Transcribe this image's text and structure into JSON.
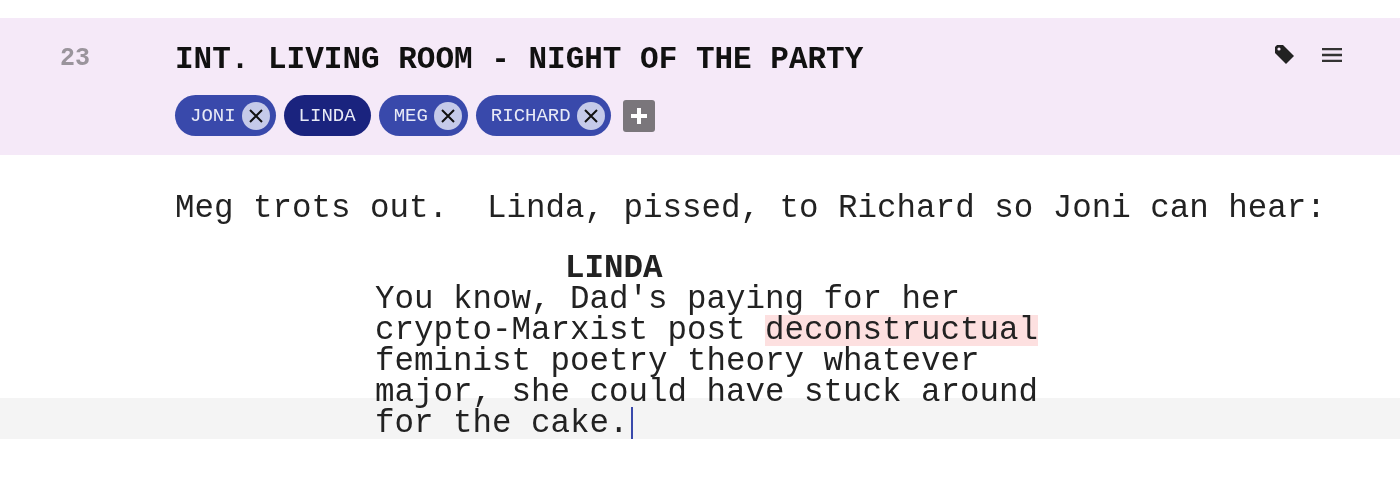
{
  "scene": {
    "number": "23",
    "heading": "INT. LIVING ROOM - NIGHT OF THE PARTY",
    "characters": [
      {
        "name": "JONI",
        "selected": false
      },
      {
        "name": "LINDA",
        "selected": true
      },
      {
        "name": "MEG",
        "selected": false
      },
      {
        "name": "RICHARD",
        "selected": false
      }
    ]
  },
  "action": "Meg trots out.  Linda, pissed, to Richard so Joni can hear:",
  "dialogue": {
    "character": "LINDA",
    "lines": [
      {
        "current": false,
        "segments": [
          {
            "text": "You know, Dad's paying for her",
            "misspelled": false
          }
        ]
      },
      {
        "current": false,
        "segments": [
          {
            "text": "crypto-Marxist post ",
            "misspelled": false
          },
          {
            "text": "deconstructual",
            "misspelled": true
          }
        ]
      },
      {
        "current": false,
        "segments": [
          {
            "text": "feminist poetry theory whatever",
            "misspelled": false
          }
        ]
      },
      {
        "current": false,
        "segments": [
          {
            "text": "major, she could have stuck around",
            "misspelled": false
          }
        ]
      },
      {
        "current": true,
        "segments": [
          {
            "text": "for the cake.",
            "misspelled": false
          }
        ]
      }
    ]
  }
}
